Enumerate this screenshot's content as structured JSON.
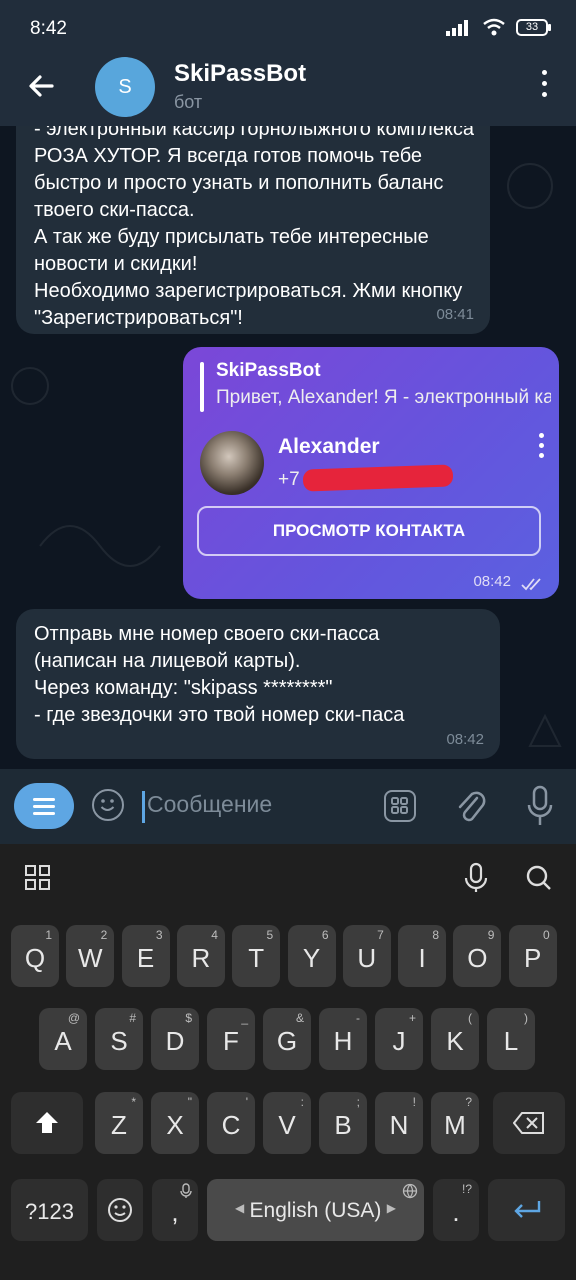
{
  "status": {
    "time": "8:42",
    "battery": "33"
  },
  "header": {
    "avatar_letter": "S",
    "title": "SkiPassBot",
    "subtitle": "бот"
  },
  "messages": [
    {
      "text": "- электронный кассир горнолыжного комплекса РОЗА ХУТОР. Я всегда готов помочь тебе быстро и просто узнать и пополнить баланс твоего ски-пасса.\nА так же буду присылать тебе интересные новости и скидки!\nНеобходимо зарегистрироваться. Жми кнопку \"Зарегистрироваться\"!",
      "time": "08:41"
    },
    {
      "reply_name": "SkiPassBot",
      "reply_text": "Привет, Alexander!   Я - электронный кассир",
      "contact_name": "Alexander",
      "contact_phone": "+7",
      "button": "ПРОСМОТР КОНТАКТА",
      "time": "08:42",
      "status_icon": "double-check-icon"
    },
    {
      "text": "Отправь мне номер своего ски-пасса\n(написан на лицевой карты).\nЧерез команду: \"skipass ********\"\n - где звездочки это твой номер ски-паса",
      "time": "08:42"
    }
  ],
  "input": {
    "placeholder": "Сообщение"
  },
  "keyboard": {
    "row1": [
      {
        "k": "Q",
        "h": "1"
      },
      {
        "k": "W",
        "h": "2"
      },
      {
        "k": "E",
        "h": "3"
      },
      {
        "k": "R",
        "h": "4"
      },
      {
        "k": "T",
        "h": "5"
      },
      {
        "k": "Y",
        "h": "6"
      },
      {
        "k": "U",
        "h": "7"
      },
      {
        "k": "I",
        "h": "8"
      },
      {
        "k": "O",
        "h": "9"
      },
      {
        "k": "P",
        "h": "0"
      }
    ],
    "row2": [
      {
        "k": "A",
        "h": "@"
      },
      {
        "k": "S",
        "h": "#"
      },
      {
        "k": "D",
        "h": "$"
      },
      {
        "k": "F",
        "h": "_"
      },
      {
        "k": "G",
        "h": "&"
      },
      {
        "k": "H",
        "h": "-"
      },
      {
        "k": "J",
        "h": "+"
      },
      {
        "k": "K",
        "h": "("
      },
      {
        "k": "L",
        "h": ")"
      }
    ],
    "row3": [
      {
        "k": "Z",
        "h": "*"
      },
      {
        "k": "X",
        "h": "\""
      },
      {
        "k": "C",
        "h": "'"
      },
      {
        "k": "V",
        "h": ":"
      },
      {
        "k": "B",
        "h": ";"
      },
      {
        "k": "N",
        "h": "!"
      },
      {
        "k": "M",
        "h": "?"
      }
    ],
    "symbols": "?123",
    "comma": ",",
    "space": "English (USA)",
    "period": ".",
    "period_hint": "!?"
  },
  "colors": {
    "accent": "#5ea6e3",
    "bubble_out": "#7b47d8",
    "bubble_in": "#222e3a",
    "redaction": "#e6243b"
  }
}
